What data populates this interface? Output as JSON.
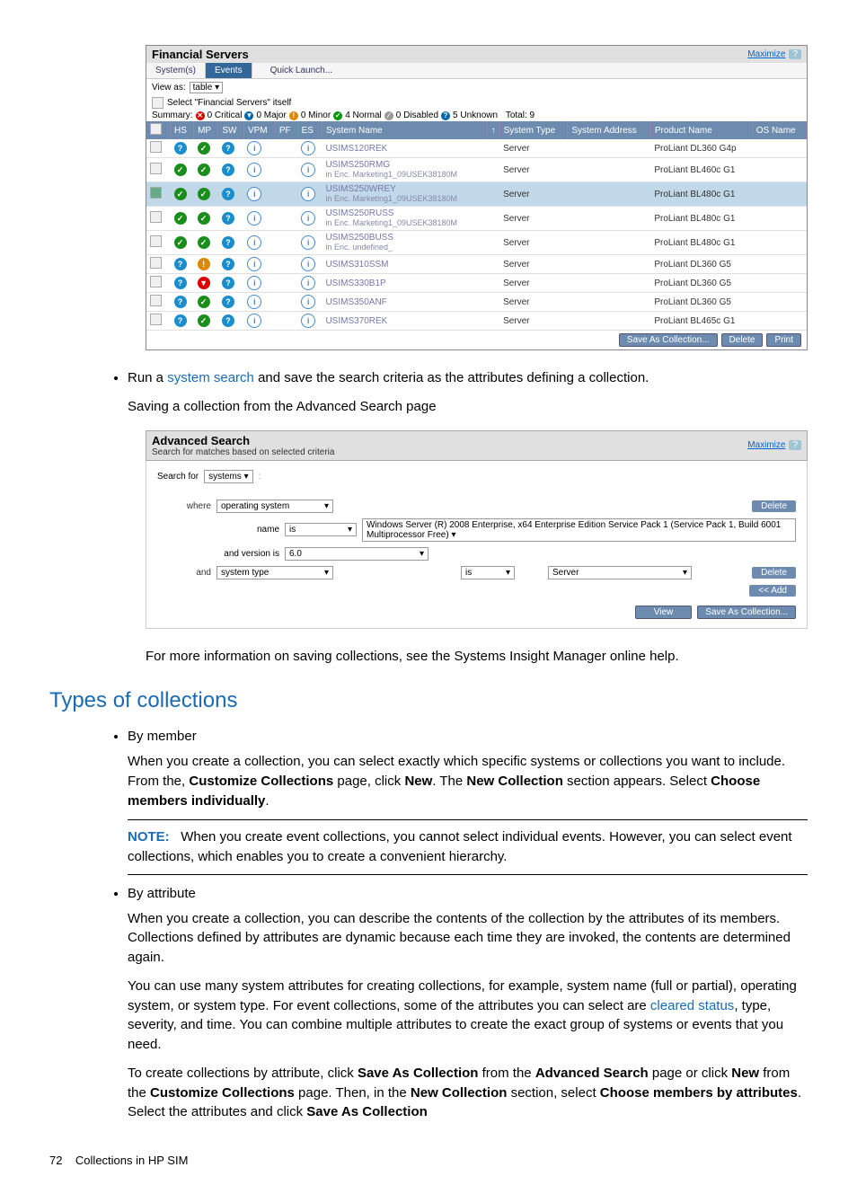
{
  "financial_servers": {
    "title": "Financial Servers",
    "maximize": "Maximize",
    "help": "?",
    "tabs": {
      "systems": "System(s)",
      "events": "Events",
      "quick_launch": "Quick Launch..."
    },
    "view_as_label": "View as:",
    "view_as_value": "table",
    "select_itself": "Select \"Financial Servers\" itself",
    "summary": {
      "label": "Summary:",
      "critical": "0 Critical",
      "major": "0 Major",
      "minor": "0 Minor",
      "normal": "4 Normal",
      "disabled": "0 Disabled",
      "unknown": "5 Unknown",
      "total": "Total: 9"
    },
    "columns": {
      "hs": "HS",
      "mp": "MP",
      "sw": "SW",
      "vpm": "VPM",
      "pf": "PF",
      "es": "ES",
      "name": "System Name",
      "type": "System Type",
      "addr": "System Address",
      "product": "Product Name",
      "os": "OS Name"
    },
    "rows": [
      {
        "name": "USIMS120REK",
        "sub": "",
        "type": "Server",
        "product": "ProLiant DL360 G4p",
        "sel": false
      },
      {
        "name": "USIMS250RMG",
        "sub": "in Enc. Marketing1_09USEK38180M",
        "type": "Server",
        "product": "ProLiant BL460c G1",
        "sel": false
      },
      {
        "name": "USIMS250WREY",
        "sub": "in Enc. Marketing1_09USEK38180M",
        "type": "Server",
        "product": "ProLiant BL480c G1",
        "sel": true
      },
      {
        "name": "USIMS250RUSS",
        "sub": "in Enc. Marketing1_09USEK38180M",
        "type": "Server",
        "product": "ProLiant BL480c G1",
        "sel": false
      },
      {
        "name": "USIMS250BUSS",
        "sub": "in Enc. undefined_",
        "type": "Server",
        "product": "ProLiant BL480c G1",
        "sel": false
      },
      {
        "name": "USIMS310SSM",
        "sub": "",
        "type": "Server",
        "product": "ProLiant DL360 G5",
        "sel": false
      },
      {
        "name": "USIMS330B1P",
        "sub": "",
        "type": "Server",
        "product": "ProLiant DL360 G5",
        "sel": false
      },
      {
        "name": "USIMS350ANF",
        "sub": "",
        "type": "Server",
        "product": "ProLiant DL360 G5",
        "sel": false
      },
      {
        "name": "USIMS370REK",
        "sub": "",
        "type": "Server",
        "product": "ProLiant BL465c G1",
        "sel": false
      }
    ],
    "buttons": {
      "save": "Save As Collection...",
      "delete": "Delete",
      "print": "Print"
    }
  },
  "bullet1": {
    "prefix": "Run a ",
    "link": "system search",
    "suffix": " and save the search criteria as the attributes defining a collection.",
    "caption": "Saving a collection from the Advanced Search page"
  },
  "advanced_search": {
    "title": "Advanced Search",
    "subtitle": "Search for matches based on selected criteria",
    "maximize": "Maximize",
    "help": "?",
    "search_for_label": "Search for",
    "search_for_value": "systems",
    "where_label": "where",
    "where_field": "operating system",
    "name_label": "name",
    "name_op": "is",
    "name_value": "Windows Server (R) 2008 Enterprise, x64 Enterprise Edition Service Pack 1 (Service Pack 1, Build 6001 Multiprocessor Free)",
    "version_label": "and version is",
    "version_value": "6.0",
    "and_label": "and",
    "and_field": "system type",
    "and_op": "is",
    "and_value": "Server",
    "delete_btn": "Delete",
    "add_btn": "<< Add",
    "view_btn": "View",
    "save_btn": "Save As Collection..."
  },
  "para_after": "For more information on saving collections, see the Systems Insight Manager online help.",
  "section_title": "Types of collections",
  "by_member": {
    "title": "By member",
    "para": "When you create a collection, you can select exactly which specific systems or collections you want to include. From the, ",
    "b1": "Customize Collections",
    "mid1": " page, click ",
    "b2": "New",
    "mid2": ". The ",
    "b3": "New Collection",
    "mid3": " section appears. Select ",
    "b4": "Choose members individually",
    "end": "."
  },
  "note": {
    "label": "NOTE:",
    "text": "When you create event collections, you cannot select individual events. However, you can select event collections, which enables you to create a convenient hierarchy."
  },
  "by_attribute": {
    "title": "By attribute",
    "p1": "When you create a collection, you can describe the contents of the collection by the attributes of its members. Collections defined by attributes are dynamic because each time they are invoked, the contents are determined again.",
    "p2a": "You can use many system attributes for creating collections, for example, system name (full or partial), operating system, or system type. For event collections, some of the attributes you can select are ",
    "p2link": "cleared status",
    "p2b": ", type, severity, and time. You can combine multiple attributes to create the exact group of systems or events that you need.",
    "p3a": "To create collections by attribute, click ",
    "p3b1": "Save As Collection",
    "p3b": " from the ",
    "p3b2": "Advanced Search",
    "p3c": " page or click ",
    "p3b3": "New",
    "p3d": " from the ",
    "p3b4": "Customize Collections",
    "p3e": " page. Then, in the ",
    "p3b5": "New Collection",
    "p3f": " section, select ",
    "p3b6": "Choose members by attributes",
    "p3g": ". Select the attributes and click ",
    "p3b7": "Save As Collection"
  },
  "footer": {
    "page": "72",
    "chapter": "Collections in HP SIM"
  }
}
